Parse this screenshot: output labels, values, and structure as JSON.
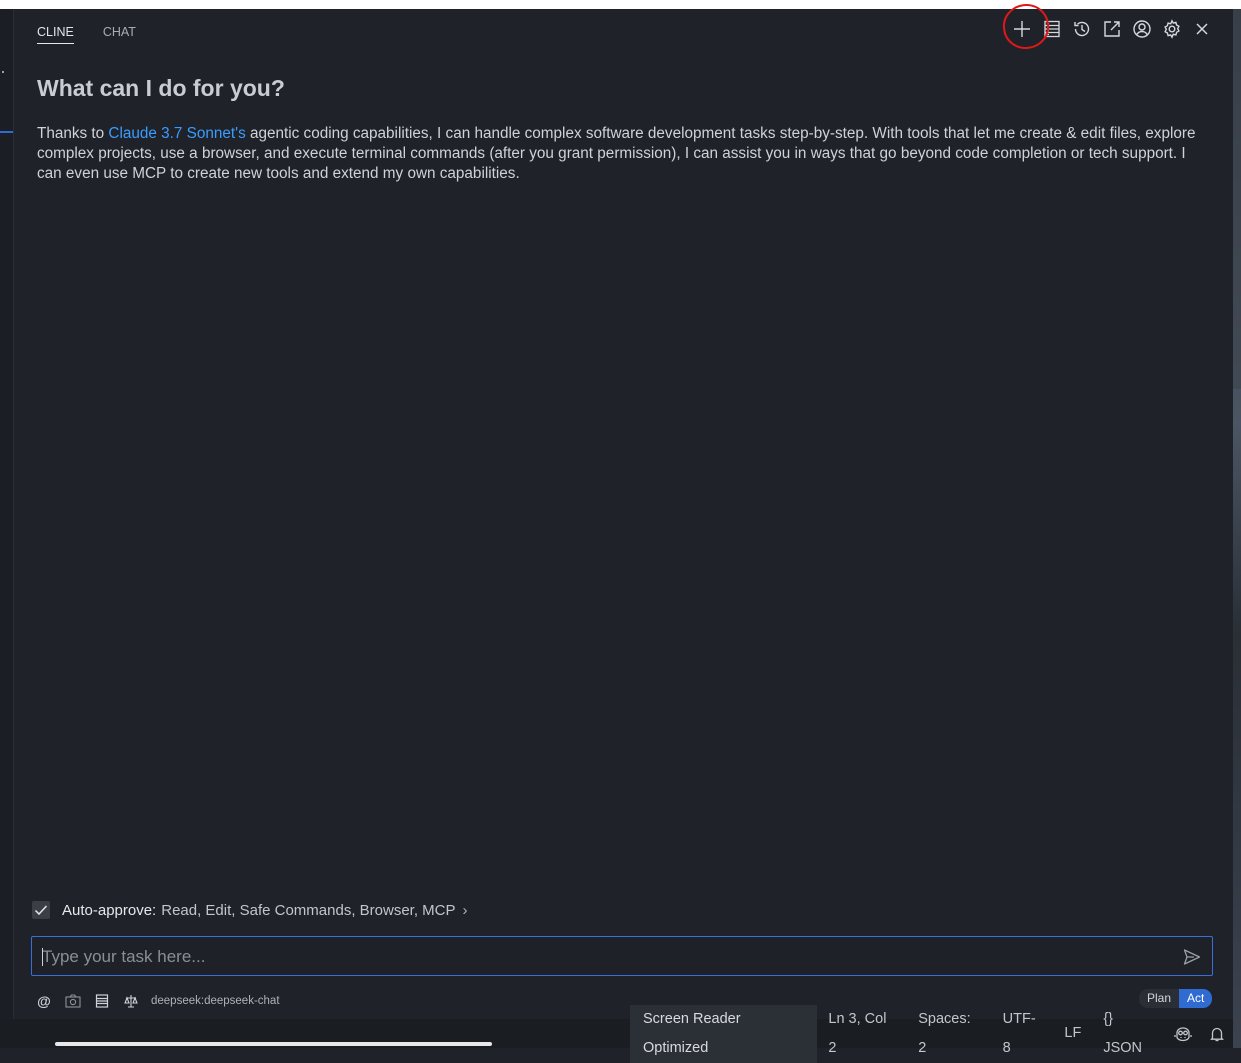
{
  "tabs": [
    {
      "label": "CLINE",
      "active": true
    },
    {
      "label": "CHAT",
      "active": false
    }
  ],
  "toolbar": {
    "icons": [
      "plus-icon",
      "server-icon",
      "history-icon",
      "popout-icon",
      "account-icon",
      "gear-icon",
      "close-icon"
    ]
  },
  "welcome": {
    "heading": "What can I do for you?",
    "intro_before": "Thanks to ",
    "intro_link": "Claude 3.7 Sonnet's",
    "intro_after": " agentic coding capabilities, I can handle complex software development tasks step-by-step. With tools that let me create & edit files, explore complex projects, use a browser, and execute terminal commands (after you grant permission), I can assist you in ways that go beyond code completion or tech support. I can even use MCP to create new tools and extend my own capabilities."
  },
  "auto_approve": {
    "checked": true,
    "label": "Auto-approve:",
    "value": "Read, Edit, Safe Commands, Browser, MCP",
    "chevron": "›"
  },
  "task_input": {
    "placeholder": "Type your task here...",
    "value": ""
  },
  "bottom": {
    "mention": "@",
    "model": "deepseek:deepseek-chat"
  },
  "modes": {
    "plan": "Plan",
    "act": "Act",
    "active": "Act"
  },
  "statusbar": {
    "screen_reader": "Screen Reader Optimized",
    "position": "Ln 3, Col 2",
    "spaces": "Spaces: 2",
    "encoding": "UTF-8",
    "eol": "LF",
    "language": "{} JSON"
  },
  "colors": {
    "background": "#1f2229",
    "accent": "#2f6bd1",
    "link": "#3b9cff",
    "annotation": "#e01818"
  }
}
